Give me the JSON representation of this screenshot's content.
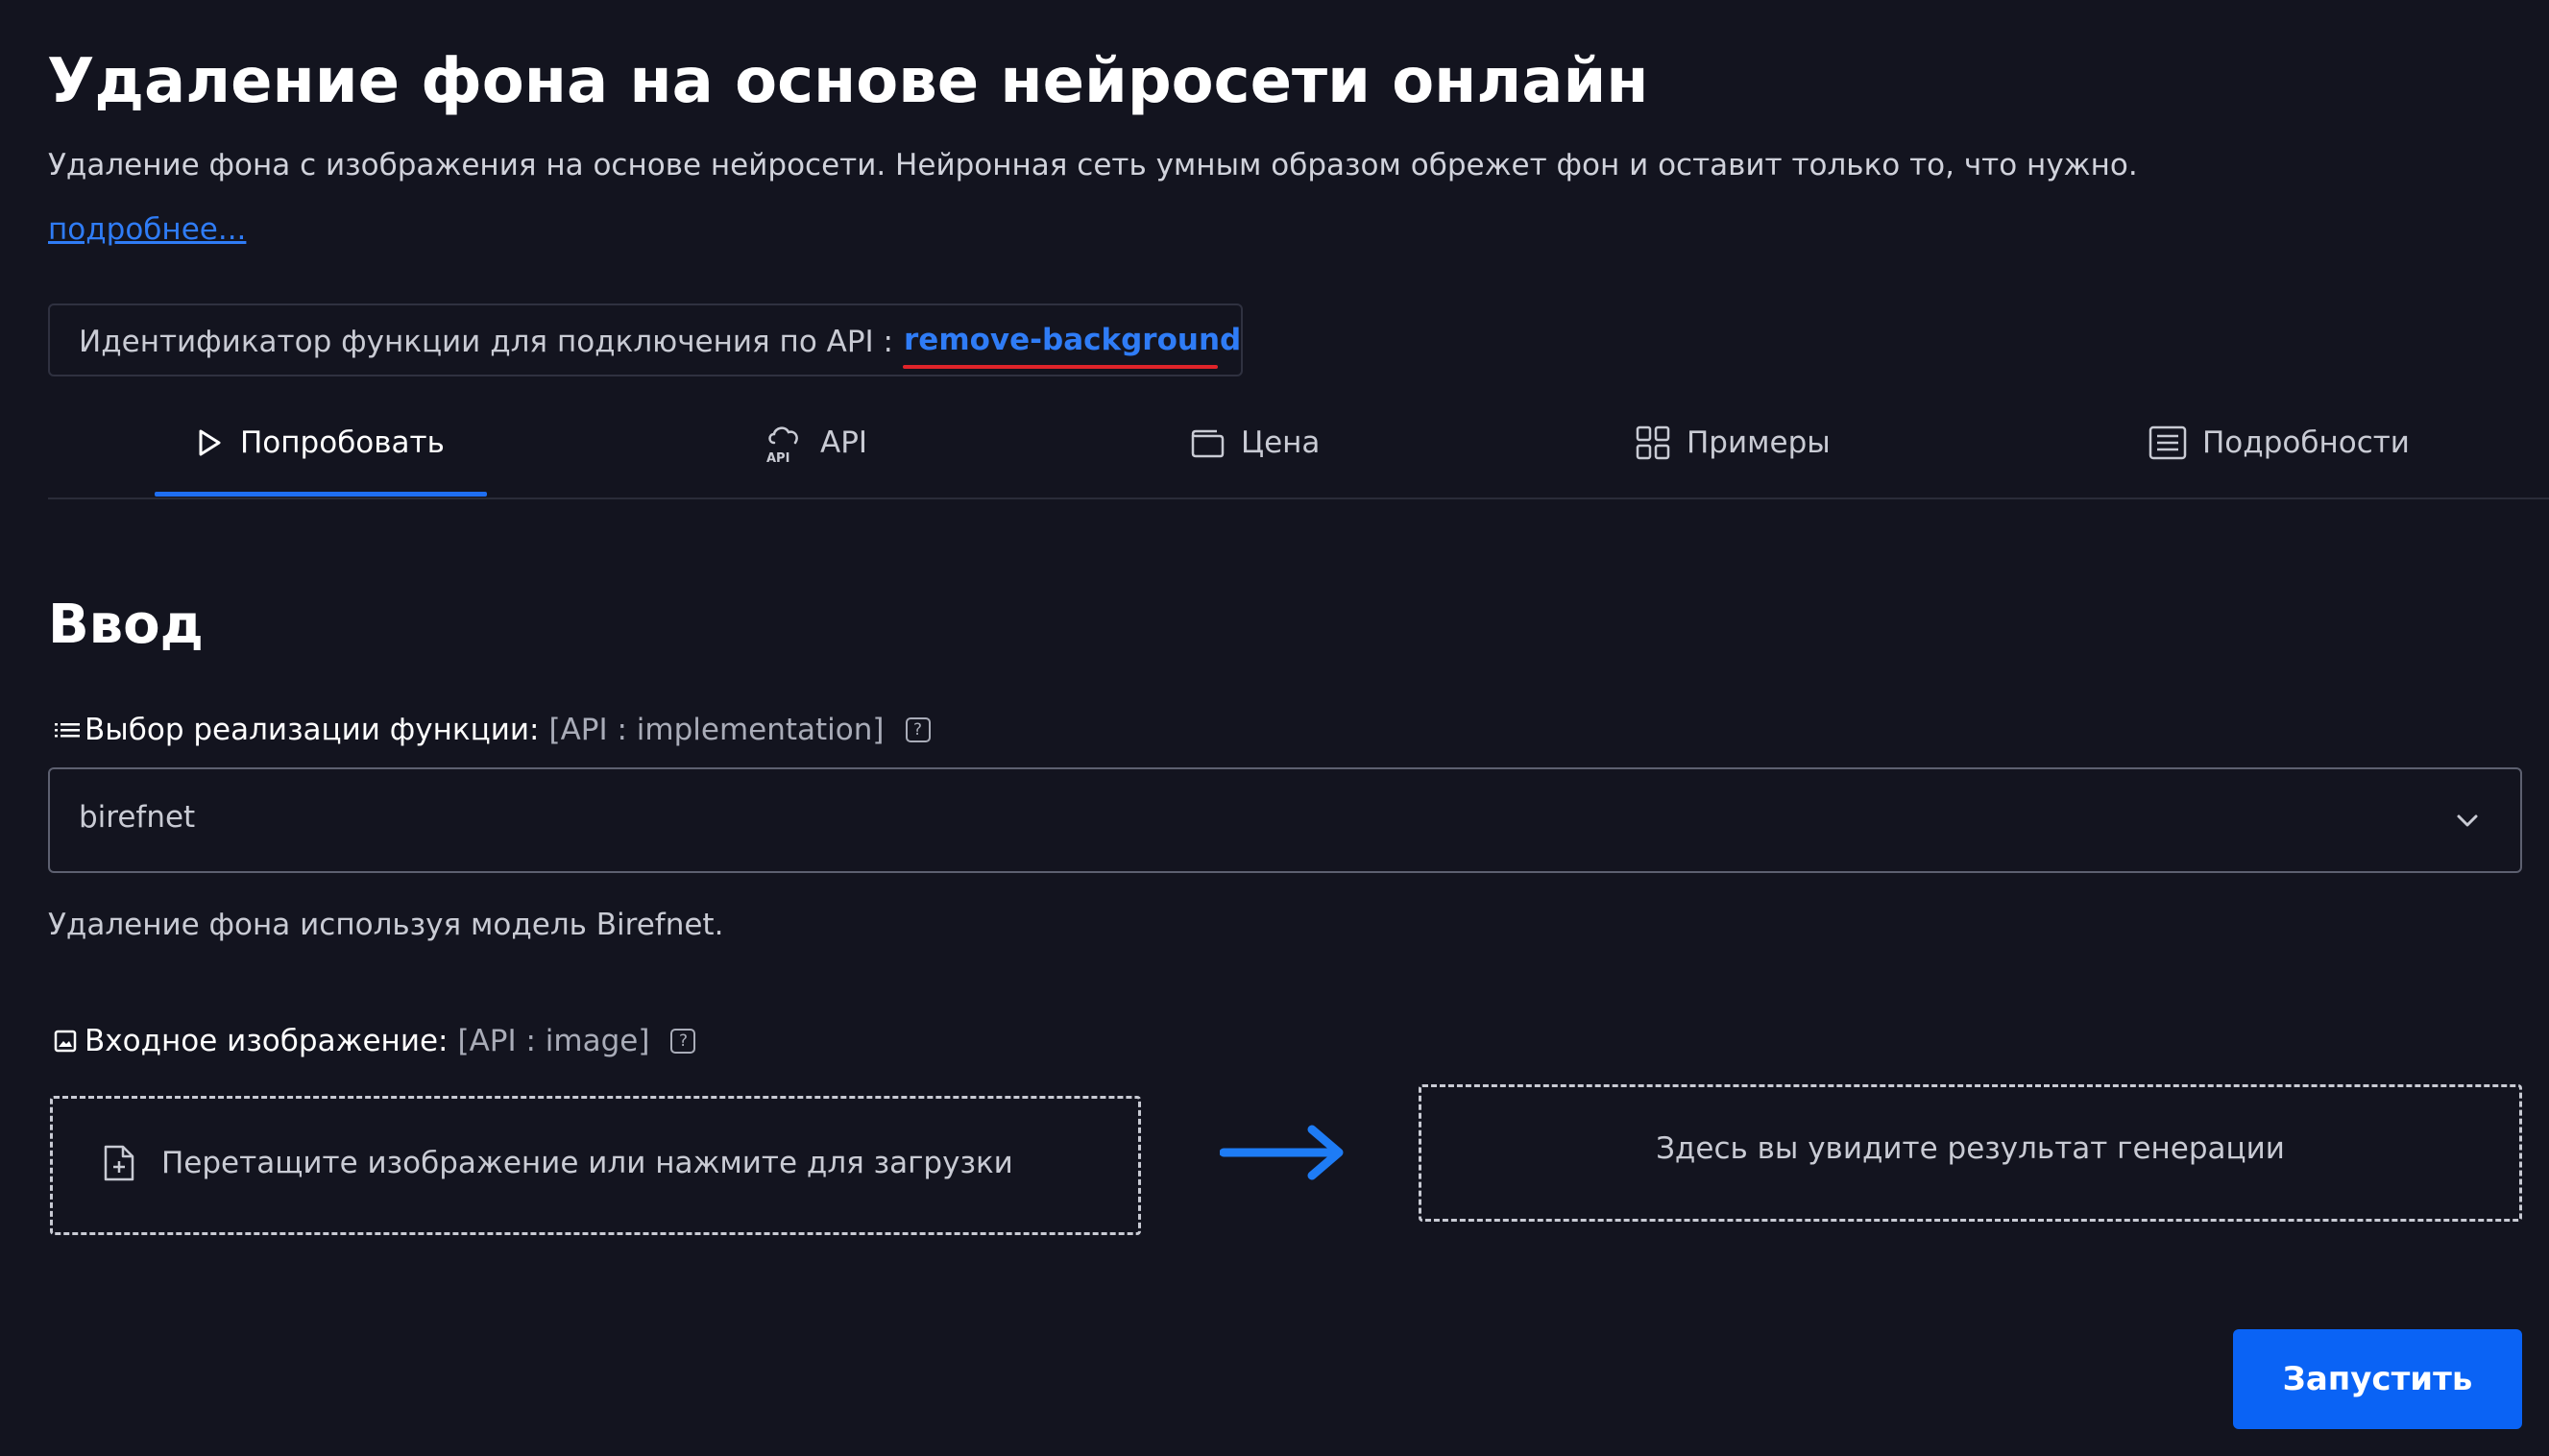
{
  "header": {
    "title": "Удаление фона на основе нейросети онлайн",
    "description": "Удаление фона с изображения на основе нейросети. Нейронная сеть умным образом обрежет фон и оставит только то, что нужно.",
    "more_link": "подробнее..."
  },
  "api_identifier": {
    "label": "Идентификатор функции для подключения по API :",
    "value": "remove-background",
    "underline_color": "#e0242a"
  },
  "tabs": [
    {
      "label": "Попробовать",
      "icon": "play-icon",
      "active": true
    },
    {
      "label": "API",
      "icon": "cloud-api-icon",
      "active": false
    },
    {
      "label": "Цена",
      "icon": "wallet-icon",
      "active": false
    },
    {
      "label": "Примеры",
      "icon": "grid-icon",
      "active": false
    },
    {
      "label": "Подробности",
      "icon": "list-details-icon",
      "active": false
    }
  ],
  "input_section": {
    "title": "Ввод",
    "implementation": {
      "label": "Выбор реализации функции:",
      "api_hint": "[API : implementation]",
      "help": "?",
      "selected": "birefnet",
      "description": "Удаление фона используя модель Birefnet."
    },
    "image": {
      "label": "Входное изображение:",
      "api_hint": "[API : image]",
      "help": "?",
      "dropzone_text": "Перетащите изображение или нажмите для загрузки"
    },
    "result_placeholder": "Здесь вы увидите результат генерации"
  },
  "actions": {
    "run_label": "Запустить"
  },
  "colors": {
    "background": "#13141f",
    "accent": "#0a63f5",
    "link": "#2f7cf6"
  }
}
